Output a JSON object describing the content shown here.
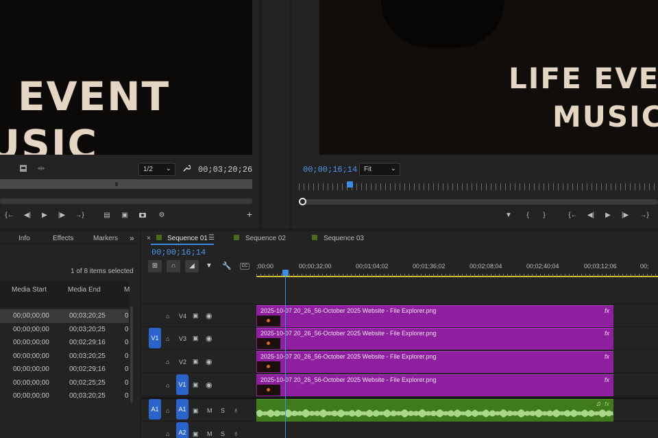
{
  "source_monitor": {
    "title_line1": "EVENT",
    "title_line2": "USIC",
    "zoom": "1/2",
    "timecode": "00;03;20;26"
  },
  "program_monitor": {
    "title_line1": "LIFE EVE",
    "title_line2": "MUSIC",
    "timecode": "00;00;16;14",
    "zoom": "Fit"
  },
  "project_panel": {
    "tabs": [
      "Info",
      "Effects",
      "Markers"
    ],
    "selection_status": "1 of 8 items selected",
    "columns": [
      "Media Start",
      "Media End",
      "M"
    ],
    "rows": [
      {
        "start": "00;00;00;00",
        "end": "00;03;20;25",
        "m": "0"
      },
      {
        "start": "00;00;00;00",
        "end": "00;03;20;25",
        "m": "0"
      },
      {
        "start": "00;00;00;00",
        "end": "00;02;29;16",
        "m": "0"
      },
      {
        "start": "00;00;00;00",
        "end": "00;03;20;25",
        "m": "0"
      },
      {
        "start": "00;00;00;00",
        "end": "00;02;29;16",
        "m": "0"
      },
      {
        "start": "00;00;00;00",
        "end": "00;02;25;25",
        "m": "0"
      },
      {
        "start": "00;00;00;00",
        "end": "00;03;20;25",
        "m": "0"
      }
    ]
  },
  "timeline": {
    "tabs": [
      "Sequence 01",
      "Sequence 02",
      "Sequence 03"
    ],
    "close_glyph": "×",
    "timecode": "00;00;16;14",
    "ruler_labels": [
      ";00;00",
      "00;00;32;00",
      "00;01;04;02",
      "00;01;36;02",
      "00;02;08;04",
      "00;02;40;04",
      "00;03;12;06",
      "00;"
    ],
    "video_tracks": [
      {
        "name": "V4",
        "source_patch": "",
        "target": ""
      },
      {
        "name": "V3",
        "source_patch": "V1",
        "target": ""
      },
      {
        "name": "V2",
        "source_patch": "",
        "target": ""
      },
      {
        "name": "V1",
        "source_patch": "",
        "target": "V1"
      }
    ],
    "audio_tracks": [
      {
        "name": "A1",
        "source_patch": "A1",
        "target": "A1",
        "m": "M",
        "s": "S"
      },
      {
        "name": "A2",
        "source_patch": "",
        "target": "A2",
        "m": "M",
        "s": "S"
      }
    ],
    "clip_name": "2025-10-07 20_26_56-October 2025 Website - File Explorer.png",
    "fx_label": "fx",
    "colors": {
      "video_clip": "#8e1f9f",
      "audio_clip": "#3f7a1c",
      "accent": "#2a63c9",
      "playhead": "#3c8ce8"
    }
  }
}
